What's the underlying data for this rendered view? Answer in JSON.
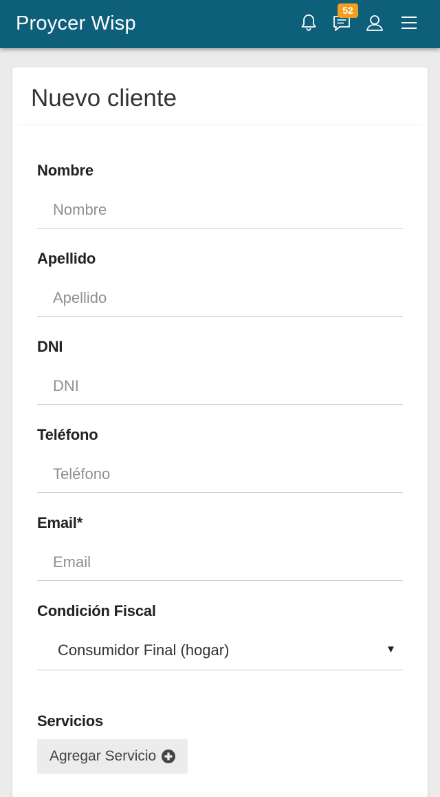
{
  "app": {
    "title": "Proycer Wisp",
    "accent_color": "#0e5f7a",
    "badge_color": "#f0a01e"
  },
  "topbar": {
    "icons": {
      "notifications": "bell-icon",
      "messages": "chat-icon",
      "profile": "user-icon",
      "menu": "hamburger-menu-icon"
    },
    "messages_badge": "52"
  },
  "form": {
    "title": "Nuevo cliente",
    "fields": {
      "nombre": {
        "label": "Nombre",
        "placeholder": "Nombre"
      },
      "apellido": {
        "label": "Apellido",
        "placeholder": "Apellido"
      },
      "dni": {
        "label": "DNI",
        "placeholder": "DNI"
      },
      "telefono": {
        "label": "Teléfono",
        "placeholder": "Teléfono"
      },
      "email": {
        "label": "Email*",
        "placeholder": "Email"
      },
      "condicion_fiscal": {
        "label": "Condición Fiscal",
        "selected": "Consumidor Final (hogar)",
        "arrow": "▼"
      }
    },
    "servicios": {
      "label": "Servicios",
      "add_button_label": "Agregar Servicio",
      "add_button_icon": "plus-circle-icon"
    }
  }
}
